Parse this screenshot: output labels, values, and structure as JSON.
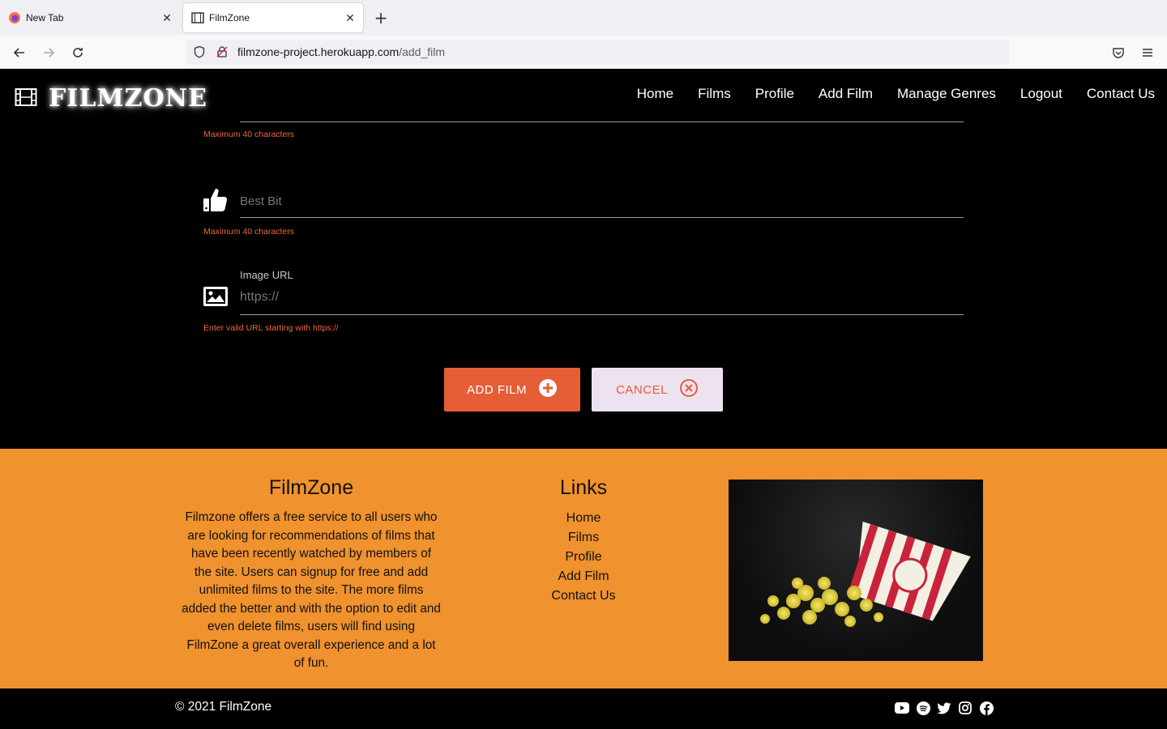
{
  "browser": {
    "tabs": [
      {
        "label": "New Tab",
        "favicon": "firefox-icon"
      },
      {
        "label": "FilmZone",
        "favicon": "film-icon"
      }
    ],
    "url_host": "filmzone-project.herokuapp.com",
    "url_path": "/add_film"
  },
  "site": {
    "logo_text": "FILMZONE",
    "nav": [
      "Home",
      "Films",
      "Profile",
      "Add Film",
      "Manage Genres",
      "Logout",
      "Contact Us"
    ]
  },
  "form": {
    "field1_hint": "Maximum 40 characters",
    "best_bit_placeholder": "Best Bit",
    "best_bit_hint": "Maximum 40 characters",
    "image_url_label": "Image URL",
    "image_url_placeholder": "https://",
    "image_url_hint": "Enter valid URL starting with https://",
    "add_button": "ADD FILM",
    "cancel_button": "CANCEL"
  },
  "footer": {
    "about_title": "FilmZone",
    "about_text": "Filmzone offers a free service to all users who are looking for recommendations of films that have been recently watched by members of the site. Users can signup for free and add unlimited films to the site. The more films added the better and with the option to edit and even delete films, users will find using FilmZone a great overall experience and a lot of fun.",
    "links_title": "Links",
    "links": [
      "Home",
      "Films",
      "Profile",
      "Add Film",
      "Contact Us"
    ],
    "copyright": "© 2021 FilmZone",
    "socials": [
      "youtube-icon",
      "spotify-icon",
      "twitter-icon",
      "instagram-icon",
      "facebook-icon"
    ]
  },
  "colors": {
    "accent": "#e55e38",
    "footer_bg": "#f0922e",
    "hint": "#f0663d"
  }
}
